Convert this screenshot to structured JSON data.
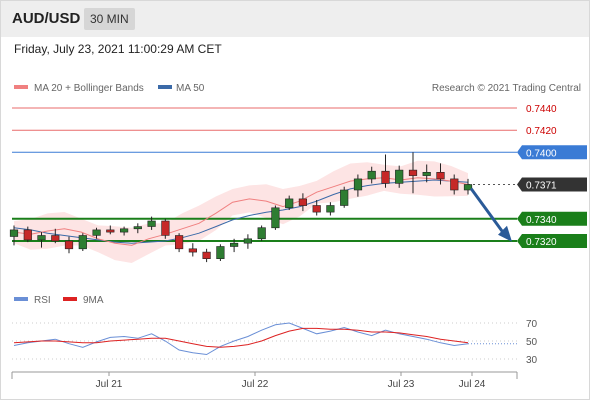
{
  "header": {
    "symbol": "AUD/USD",
    "timeframe": "30 MIN",
    "timestamp": "Friday, July 23, 2021 11:00:29 AM CET"
  },
  "legend": {
    "ma20_label": "MA 20 + Bollinger Bands",
    "ma50_label": "MA 50",
    "copyright": "Research © 2021 Trading Central"
  },
  "colors": {
    "candle_up": "#2e7d32",
    "candle_down": "#c62828",
    "ma20": "#f08080",
    "band_fill": "#fde4e4",
    "ma50": "#3b6aa8",
    "resistance": "#e96b6b",
    "pivot": "#3a7bd5",
    "support": "#1a7f1a",
    "current_price": "#333333",
    "arrow": "#2a5a98",
    "rsi": "#6a8fd6",
    "rsi_ma": "#dd2222"
  },
  "levels": [
    {
      "value": 0.744,
      "label": "0.7440",
      "kind": "resistance"
    },
    {
      "value": 0.742,
      "label": "0.7420",
      "kind": "resistance"
    },
    {
      "value": 0.74,
      "label": "0.7400",
      "kind": "pivot"
    },
    {
      "value": 0.7371,
      "label": "0.7371",
      "kind": "current"
    },
    {
      "value": 0.734,
      "label": "0.7340",
      "kind": "support"
    },
    {
      "value": 0.732,
      "label": "0.7320",
      "kind": "support"
    }
  ],
  "x_labels": [
    "Jul 21",
    "Jul 22",
    "Jul 23",
    "Jul 24"
  ],
  "rsi": {
    "label": "RSI",
    "ma_label": "9MA",
    "ticks": [
      70,
      50,
      30
    ]
  },
  "chart_data": {
    "type": "candlestick",
    "title": "AUD/USD 30 MIN",
    "ylim": [
      0.7295,
      0.745
    ],
    "x_ticks": [
      "Jul 21",
      "Jul 22",
      "Jul 23",
      "Jul 24"
    ],
    "series": [
      {
        "name": "MA 20 + Bollinger Bands",
        "values": [
          0.7328,
          0.7326,
          0.7329,
          0.7331,
          0.7328,
          0.7322,
          0.7318,
          0.7316,
          0.7322,
          0.7326,
          0.7331,
          0.7336,
          0.7345,
          0.7355,
          0.7358,
          0.7356,
          0.7351,
          0.7356,
          0.7364,
          0.7369,
          0.7374,
          0.7376,
          0.7377,
          0.7375,
          0.7377,
          0.7376,
          0.7374,
          0.7371
        ]
      },
      {
        "name": "MA 50",
        "values": [
          0.7332,
          0.733,
          0.7327,
          0.7325,
          0.7323,
          0.7321,
          0.7319,
          0.7318,
          0.7319,
          0.732,
          0.7323,
          0.7327,
          0.7333,
          0.7339,
          0.7343,
          0.7346,
          0.7348,
          0.7351,
          0.7356,
          0.7362,
          0.7367,
          0.737,
          0.7372,
          0.7373,
          0.7374,
          0.7375,
          0.7374,
          0.7373
        ]
      }
    ],
    "ohlc": [
      {
        "o": 0.7324,
        "h": 0.7334,
        "l": 0.7316,
        "c": 0.733
      },
      {
        "o": 0.733,
        "h": 0.7333,
        "l": 0.7319,
        "c": 0.7321
      },
      {
        "o": 0.7321,
        "h": 0.7328,
        "l": 0.7314,
        "c": 0.7325
      },
      {
        "o": 0.7325,
        "h": 0.7331,
        "l": 0.7318,
        "c": 0.732
      },
      {
        "o": 0.732,
        "h": 0.7324,
        "l": 0.7309,
        "c": 0.7313
      },
      {
        "o": 0.7313,
        "h": 0.7327,
        "l": 0.7311,
        "c": 0.7325
      },
      {
        "o": 0.7325,
        "h": 0.7332,
        "l": 0.7322,
        "c": 0.733
      },
      {
        "o": 0.733,
        "h": 0.7334,
        "l": 0.7326,
        "c": 0.7328
      },
      {
        "o": 0.7328,
        "h": 0.7333,
        "l": 0.7325,
        "c": 0.7331
      },
      {
        "o": 0.7331,
        "h": 0.7336,
        "l": 0.7327,
        "c": 0.7333
      },
      {
        "o": 0.7333,
        "h": 0.7342,
        "l": 0.733,
        "c": 0.7338
      },
      {
        "o": 0.7338,
        "h": 0.734,
        "l": 0.7322,
        "c": 0.7325
      },
      {
        "o": 0.7325,
        "h": 0.7327,
        "l": 0.731,
        "c": 0.7313
      },
      {
        "o": 0.7313,
        "h": 0.7318,
        "l": 0.7306,
        "c": 0.731
      },
      {
        "o": 0.731,
        "h": 0.7313,
        "l": 0.7301,
        "c": 0.7304
      },
      {
        "o": 0.7304,
        "h": 0.7317,
        "l": 0.7302,
        "c": 0.7315
      },
      {
        "o": 0.7315,
        "h": 0.7322,
        "l": 0.731,
        "c": 0.7318
      },
      {
        "o": 0.7318,
        "h": 0.7326,
        "l": 0.7313,
        "c": 0.7322
      },
      {
        "o": 0.7322,
        "h": 0.7334,
        "l": 0.732,
        "c": 0.7332
      },
      {
        "o": 0.7332,
        "h": 0.7352,
        "l": 0.733,
        "c": 0.735
      },
      {
        "o": 0.735,
        "h": 0.7361,
        "l": 0.7348,
        "c": 0.7358
      },
      {
        "o": 0.7358,
        "h": 0.7363,
        "l": 0.7347,
        "c": 0.7352
      },
      {
        "o": 0.7352,
        "h": 0.7357,
        "l": 0.7343,
        "c": 0.7346
      },
      {
        "o": 0.7346,
        "h": 0.7355,
        "l": 0.7343,
        "c": 0.7352
      },
      {
        "o": 0.7352,
        "h": 0.7369,
        "l": 0.735,
        "c": 0.7366
      },
      {
        "o": 0.7366,
        "h": 0.738,
        "l": 0.736,
        "c": 0.7376
      },
      {
        "o": 0.7376,
        "h": 0.7387,
        "l": 0.7372,
        "c": 0.7383
      },
      {
        "o": 0.7383,
        "h": 0.7398,
        "l": 0.7368,
        "c": 0.7372
      },
      {
        "o": 0.7372,
        "h": 0.7388,
        "l": 0.7368,
        "c": 0.7384
      },
      {
        "o": 0.7384,
        "h": 0.74,
        "l": 0.7363,
        "c": 0.7379
      },
      {
        "o": 0.7379,
        "h": 0.7389,
        "l": 0.7373,
        "c": 0.7382
      },
      {
        "o": 0.7382,
        "h": 0.739,
        "l": 0.7371,
        "c": 0.7376
      },
      {
        "o": 0.7376,
        "h": 0.738,
        "l": 0.7362,
        "c": 0.7366
      },
      {
        "o": 0.7366,
        "h": 0.7376,
        "l": 0.7362,
        "c": 0.7371
      }
    ],
    "rsi_values": [
      45,
      48,
      50,
      52,
      47,
      43,
      49,
      54,
      55,
      53,
      58,
      50,
      40,
      37,
      35,
      44,
      50,
      55,
      62,
      68,
      70,
      64,
      58,
      61,
      65,
      60,
      56,
      62,
      58,
      55,
      52,
      48,
      45,
      47
    ],
    "rsi_ma_values": [
      48,
      49,
      50,
      50,
      49,
      48,
      48,
      50,
      51,
      52,
      53,
      53,
      50,
      47,
      44,
      43,
      44,
      46,
      50,
      56,
      61,
      64,
      64,
      63,
      63,
      62,
      60,
      60,
      59,
      57,
      55,
      52,
      50,
      48
    ],
    "rsi_ylim": [
      20,
      80
    ]
  }
}
